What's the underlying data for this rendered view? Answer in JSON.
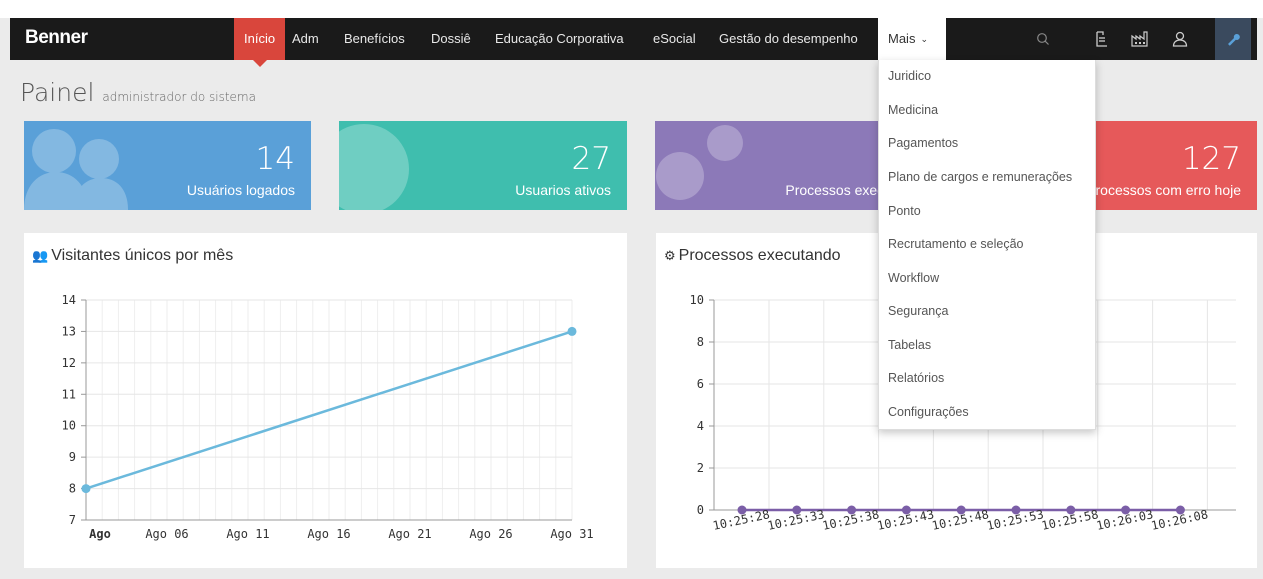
{
  "brand": "Benner",
  "nav": {
    "items": [
      {
        "label": "Início",
        "state": "active"
      },
      {
        "label": "Adm"
      },
      {
        "label": "Benefícios"
      },
      {
        "label": "Dossiê"
      },
      {
        "label": "Educação Corporativa"
      },
      {
        "label": "eSocial"
      },
      {
        "label": "Gestão do desempenho"
      },
      {
        "label": "Mais",
        "state": "open"
      }
    ],
    "icons": [
      "search-icon",
      "document-list-icon",
      "factory-icon",
      "user-icon",
      "wrench-icon"
    ]
  },
  "dropdown": {
    "items": [
      "Juridico",
      "Medicina",
      "Pagamentos",
      "Plano de cargos e remunerações",
      "Ponto",
      "Recrutamento e seleção",
      "Workflow",
      "Segurança",
      "Tabelas",
      "Relatórios",
      "Configurações"
    ]
  },
  "page": {
    "title": "Painel",
    "subtitle": "administrador do sistema"
  },
  "tiles": [
    {
      "value": "14",
      "label": "Usuários logados",
      "color": "#5aa0d8",
      "icon": "users-icon"
    },
    {
      "value": "27",
      "label": "Usuarios ativos",
      "color": "#3fbeae",
      "icon": "globe-icon"
    },
    {
      "value": "",
      "label": "Processos executando",
      "color": "#8c79b8",
      "icon": "gears-icon"
    },
    {
      "value": "127",
      "label": "Processos com erro hoje",
      "color": "#e6595a",
      "icon": "warning-icon"
    }
  ],
  "panels": {
    "left_title": "Visitantes únicos por mês",
    "right_title": "Processos executando"
  },
  "chart_data": [
    {
      "type": "line",
      "title": "Visitantes únicos por mês",
      "x_ticks": [
        "Ago",
        "Ago 06",
        "Ago 11",
        "Ago 16",
        "Ago 21",
        "Ago 26",
        "Ago 31"
      ],
      "x": [
        "Ago 01",
        "Ago 31"
      ],
      "series": [
        {
          "values": [
            8,
            13
          ],
          "color": "#6bb9dc"
        }
      ],
      "ylim": [
        7,
        14
      ],
      "y_ticks": [
        7,
        8,
        9,
        10,
        11,
        12,
        13,
        14
      ],
      "grid": true
    },
    {
      "type": "line",
      "title": "Processos executando",
      "x": [
        "10:25:28",
        "10:25:33",
        "10:25:38",
        "10:25:43",
        "10:25:48",
        "10:25:53",
        "10:25:58",
        "10:26:03",
        "10:26:08"
      ],
      "series": [
        {
          "values": [
            0,
            0,
            0,
            0,
            0,
            0,
            0,
            0,
            0
          ],
          "color": "#7b5ea7"
        }
      ],
      "ylim": [
        0,
        10
      ],
      "y_ticks": [
        0,
        2,
        4,
        6,
        8,
        10
      ],
      "grid": true
    }
  ]
}
